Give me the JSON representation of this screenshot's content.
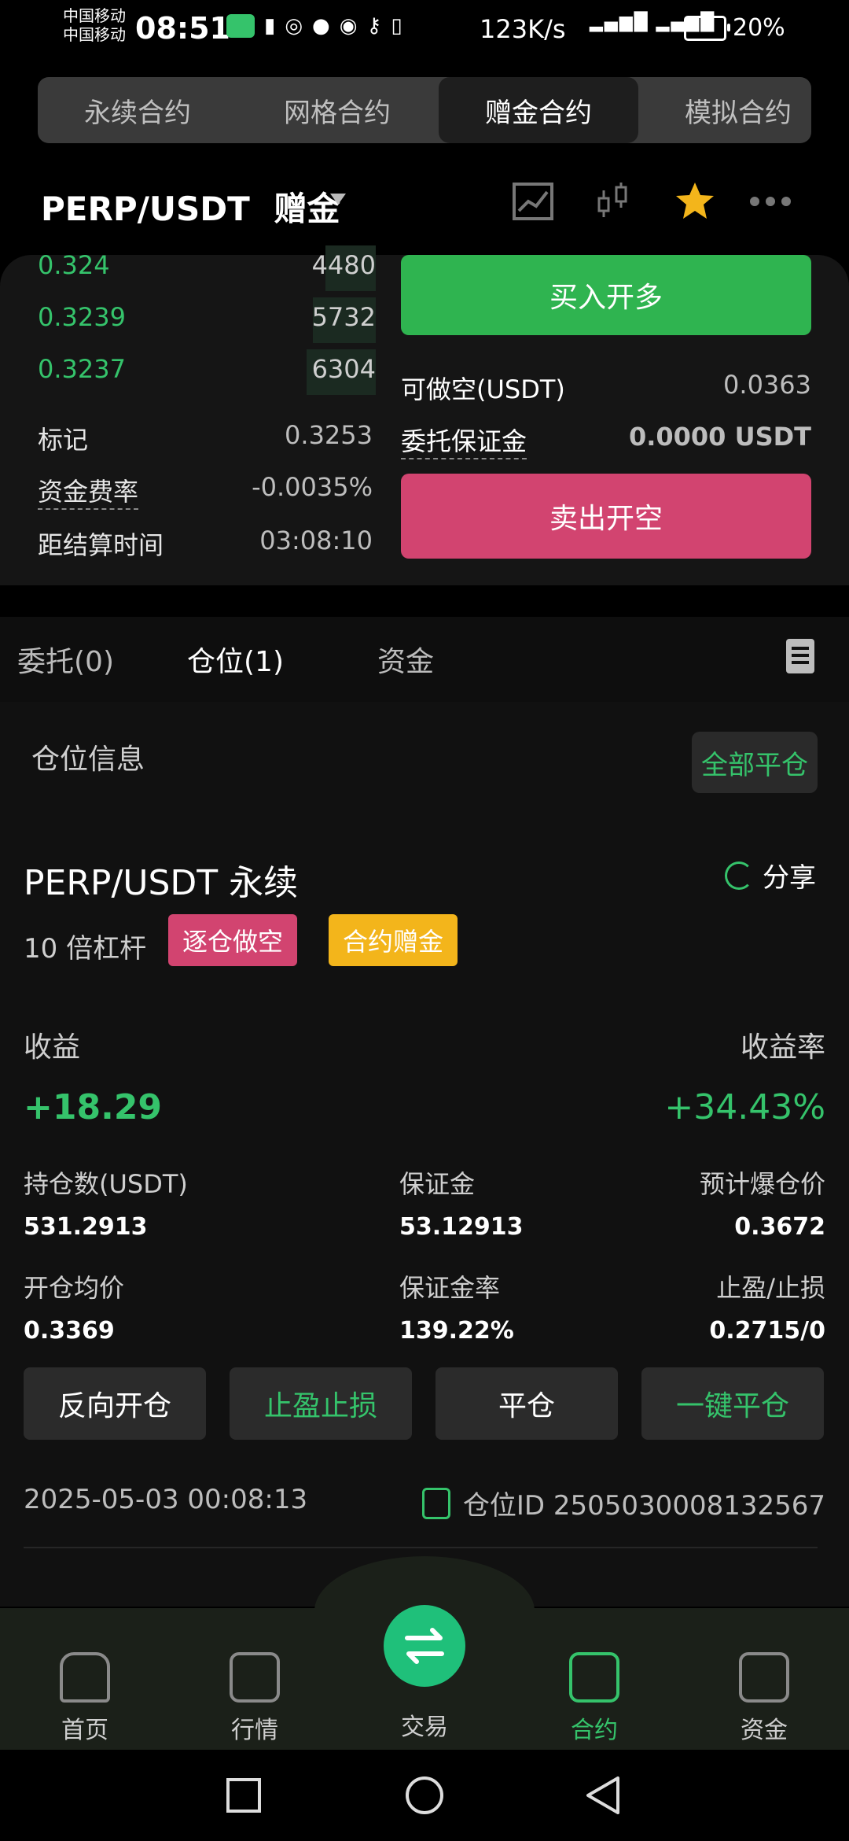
{
  "status_bar": {
    "carrier1": "中国移动",
    "carrier2": "中国移动",
    "time": "08:51",
    "speed": "123K/s",
    "battery": "20%"
  },
  "top_tabs": [
    "永续合约",
    "网格合约",
    "赠金合约",
    "模拟合约"
  ],
  "header": {
    "pair": "PERP/USDT",
    "mode": "赠金"
  },
  "order_book": [
    {
      "price": "0.324",
      "qty": "4480"
    },
    {
      "price": "0.3239",
      "qty": "5732"
    },
    {
      "price": "0.3237",
      "qty": "6304"
    }
  ],
  "market_info": {
    "mark_label": "标记",
    "mark_value": "0.3253",
    "funding_label": "资金费率",
    "funding_value": "-0.0035%",
    "settle_label": "距结算时间",
    "settle_value": "03:08:10"
  },
  "trade_form": {
    "buy_label": "买入开多",
    "short_label": "可做空(USDT)",
    "short_value": "0.0363",
    "margin_label": "委托保证金",
    "margin_value": "0.0000 USDT",
    "sell_label": "卖出开空"
  },
  "tabs": [
    "委托(0)",
    "仓位(1)",
    "资金"
  ],
  "position": {
    "section_title": "仓位信息",
    "close_all": "全部平仓",
    "name": "PERP/USDT 永续",
    "share": "分享",
    "leverage": "10 倍杠杆",
    "badge1": "逐仓做空",
    "badge2": "合约赠金",
    "pnl_label": "收益",
    "pnl_rate_label": "收益率",
    "pnl": "+18.29",
    "pnl_rate": "+34.43%",
    "size_label": "持仓数(USDT)",
    "size": "531.2913",
    "margin_label": "保证金",
    "margin": "53.12913",
    "liq_label": "预计爆仓价",
    "liq": "0.3672",
    "entry_label": "开仓均价",
    "entry": "0.3369",
    "ratio_label": "保证金率",
    "ratio": "139.22%",
    "tpsl_label": "止盈/止损",
    "tpsl": "0.2715/0",
    "actions": [
      "反向开仓",
      "止盈止损",
      "平仓",
      "一键平仓"
    ],
    "date": "2025-05-03 00:08:13",
    "id": "仓位ID 2505030008132567"
  },
  "bottom_nav": [
    "首页",
    "行情",
    "交易",
    "合约",
    "资金"
  ]
}
